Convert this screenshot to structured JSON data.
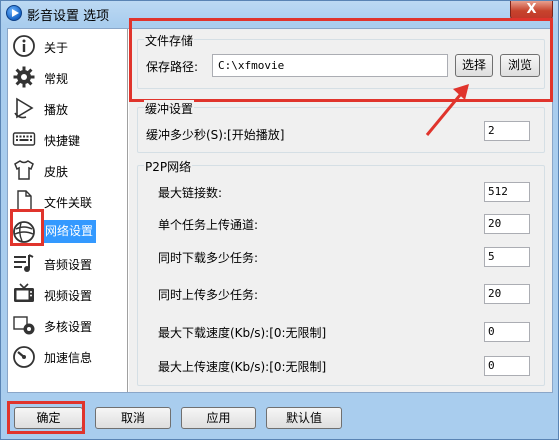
{
  "window": {
    "title": "影音设置 选项",
    "close_label": "X"
  },
  "sidebar": {
    "items": [
      {
        "label": "关于",
        "icon": "info-icon"
      },
      {
        "label": "常规",
        "icon": "gear-icon"
      },
      {
        "label": "播放",
        "icon": "play-icon"
      },
      {
        "label": "快捷键",
        "icon": "keyboard-icon"
      },
      {
        "label": "皮肤",
        "icon": "tshirt-icon"
      },
      {
        "label": "文件关联",
        "icon": "file-icon"
      },
      {
        "label": "网络设置",
        "icon": "network-icon"
      },
      {
        "label": "音频设置",
        "icon": "audio-icon"
      },
      {
        "label": "视频设置",
        "icon": "tv-icon"
      },
      {
        "label": "多核设置",
        "icon": "multicore-icon"
      },
      {
        "label": "加速信息",
        "icon": "speedometer-icon"
      }
    ],
    "active_index": 6
  },
  "storage": {
    "title": "文件存储",
    "path_label": "保存路径:",
    "path_value": "C:\\xfmovie",
    "select_label": "选择",
    "browse_label": "浏览"
  },
  "buffer": {
    "title": "缓冲设置",
    "label": "缓冲多少秒(S):[开始播放]",
    "value": "2"
  },
  "p2p": {
    "title": "P2P网络",
    "rows": [
      {
        "label": "最大链接数:",
        "value": "512"
      },
      {
        "label": "单个任务上传通道:",
        "value": "20"
      },
      {
        "label": "同时下载多少任务:",
        "value": "5"
      },
      {
        "label": "同时上传多少任务:",
        "value": "20"
      },
      {
        "label": "最大下载速度(Kb/s):[0:无限制]",
        "value": "0"
      },
      {
        "label": "最大上传速度(Kb/s):[0:无限制]",
        "value": "0"
      }
    ]
  },
  "footer": {
    "ok_label": "确定",
    "cancel_label": "取消",
    "apply_label": "应用",
    "default_label": "默认值"
  },
  "colors": {
    "highlight": "#e0342c",
    "selection": "#3399ff"
  }
}
